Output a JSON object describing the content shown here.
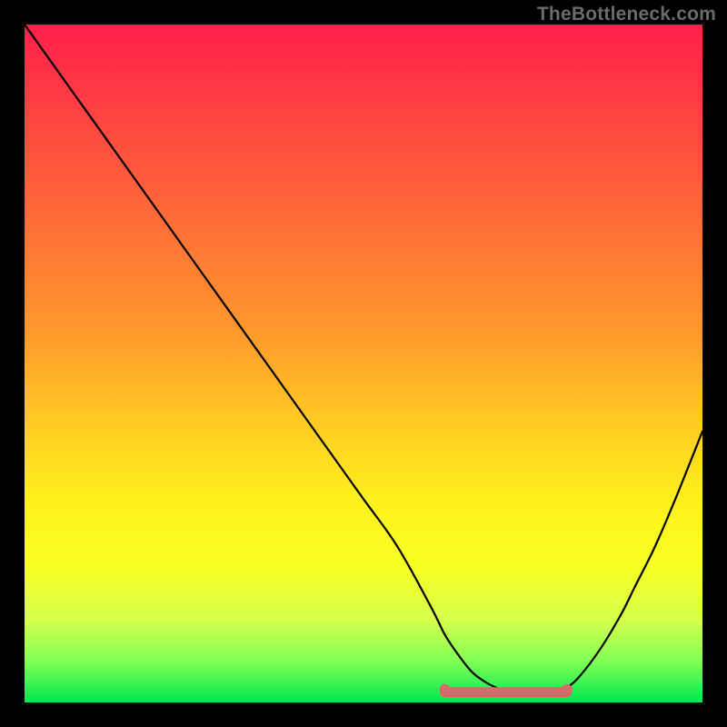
{
  "watermark": "TheBottleneck.com",
  "chart_data": {
    "type": "line",
    "title": "",
    "xlabel": "",
    "ylabel": "",
    "xlim": [
      0,
      100
    ],
    "ylim": [
      0,
      100
    ],
    "x": [
      0,
      5,
      10,
      15,
      20,
      25,
      30,
      35,
      40,
      45,
      50,
      55,
      60,
      62,
      64,
      66,
      68,
      70,
      72,
      74,
      76,
      78,
      80,
      82,
      85,
      88,
      90,
      93,
      96,
      100
    ],
    "y": [
      100,
      93,
      86,
      79,
      72,
      65,
      58,
      51,
      44,
      37,
      30,
      23,
      14,
      10,
      7,
      4.5,
      3,
      2,
      1.3,
      1,
      1,
      1.3,
      2.2,
      4,
      8,
      13,
      17,
      23,
      30,
      40
    ],
    "optimum_band": {
      "x_start": 62,
      "x_end": 80,
      "y": 1.5
    },
    "gradient_meaning": "top=red=high bottleneck, bottom=green=low bottleneck",
    "colors": {
      "gradient_top": "#ff1f4a",
      "gradient_bottom": "#00e852",
      "curve": "#000000",
      "band": "#d66a6a"
    }
  }
}
